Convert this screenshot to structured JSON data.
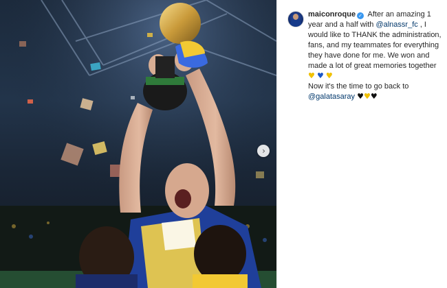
{
  "post": {
    "photo_alt": "",
    "next_icon": "chevron-right-icon"
  },
  "caption": {
    "username": "maiconroque",
    "verified": true,
    "text_part1": "After an amazing 1 year and a half with ",
    "mention_club": "@alnassr_fc",
    "text_part2": " , I would like to THANK the administration, fans, and my teammates for everything they have done for me. We won and made a lot of great memories together ",
    "hearts_line1": [
      "yellow",
      "blue",
      "yellow"
    ],
    "text_part3": "Now it's the time to go back to ",
    "mention_next_club": "@galatasaray",
    "hearts_line2": [
      "black",
      "yellow",
      "black"
    ]
  },
  "colors": {
    "mention": "#00376b",
    "verified_badge": "#3897f0",
    "heart_yellow": "#f2c200",
    "heart_blue": "#1a56c9",
    "heart_black": "#111111"
  }
}
